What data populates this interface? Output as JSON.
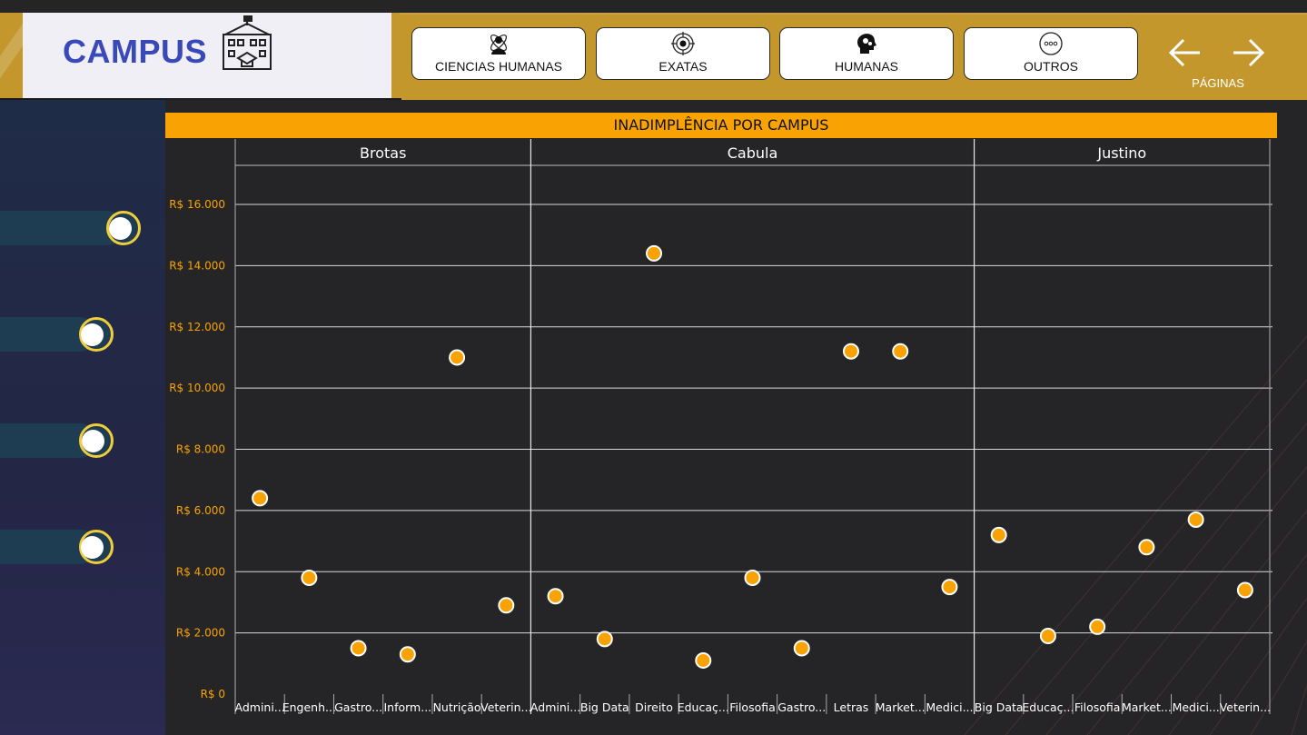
{
  "header": {
    "logo_text": "CAMPUS",
    "categories": [
      {
        "label": "CIENCIAS HUMANAS",
        "icon": "person-atom-icon"
      },
      {
        "label": "EXATAS",
        "icon": "target-icon"
      },
      {
        "label": "HUMANAS",
        "icon": "head-gears-icon"
      },
      {
        "label": "OUTROS",
        "icon": "more-dots-icon"
      }
    ],
    "pages_label": "PÁGINAS"
  },
  "colors": {
    "header_gold": "#c3972c",
    "title_bar": "#f8a303",
    "point_fill": "#f8a303",
    "axis_label": "#f8a303",
    "logo_text": "#3a49b8",
    "toggle_track": "#1f3d52",
    "toggle_ring": "#f1cd3a"
  },
  "chart_data": {
    "type": "scatter",
    "title": "INADIMPLÊNCIA POR CAMPUS",
    "ylim": [
      0,
      16000
    ],
    "y_ticks": [
      "R$ 0",
      "R$ 2.000",
      "R$ 4.000",
      "R$ 6.000",
      "R$ 8.000",
      "R$ 10.000",
      "R$ 12.000",
      "R$ 14.000",
      "R$ 16.000"
    ],
    "grid": true,
    "panels": [
      {
        "name": "Brotas",
        "categories": [
          "Admini...",
          "Engenh...",
          "Gastro...",
          "Inform...",
          "Nutrição",
          "Veterin..."
        ],
        "values": [
          6400,
          3800,
          1500,
          1300,
          11000,
          2900
        ]
      },
      {
        "name": "Cabula",
        "categories": [
          "Admini...",
          "Big Data",
          "Direito",
          "Educaç...",
          "Filosofia",
          "Gastro...",
          "Letras",
          "Market...",
          "Medici..."
        ],
        "values": [
          3200,
          1800,
          14400,
          1100,
          3800,
          1500,
          11200,
          11200,
          3500
        ]
      },
      {
        "name": "Justino",
        "categories": [
          "Big Data",
          "Educaç...",
          "Filosofia",
          "Market...",
          "Medici...",
          "Veterin..."
        ],
        "values": [
          5200,
          1900,
          2200,
          4800,
          5700,
          3400
        ]
      }
    ]
  }
}
